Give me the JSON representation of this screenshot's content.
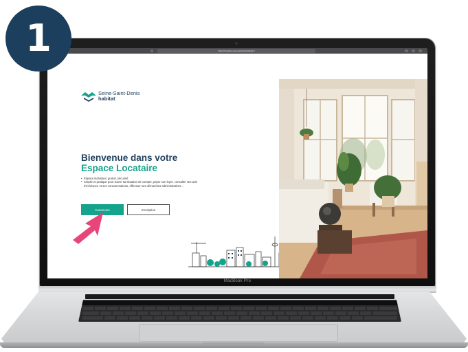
{
  "step_badge": {
    "number": "1"
  },
  "laptop": {
    "model_label": "MacBook Pro"
  },
  "browser": {
    "address": "https://locataire.seinesaintdenishabitat.fr"
  },
  "brand": {
    "name_line1": "Seine-Saint-Denis",
    "name_line2": "habitat",
    "navy": "#1d3f5e",
    "teal": "#14a38b"
  },
  "hero": {
    "title_line1": "Bienvenue dans votre",
    "title_line2": "Espace Locataire"
  },
  "features": [
    "Espace individuel, gratuit, sécurisé",
    "Simple et pratique pour suivre sa situation de compte, payer son loyer, consulter ses avis d'échéance et ses consommations, effectuer ses démarches administratives..."
  ],
  "buttons": {
    "connect_label": "Connexion",
    "signup_label": "Inscription"
  },
  "pointer": {
    "color": "#e8457a",
    "icon": "arrow-pointer-icon"
  }
}
